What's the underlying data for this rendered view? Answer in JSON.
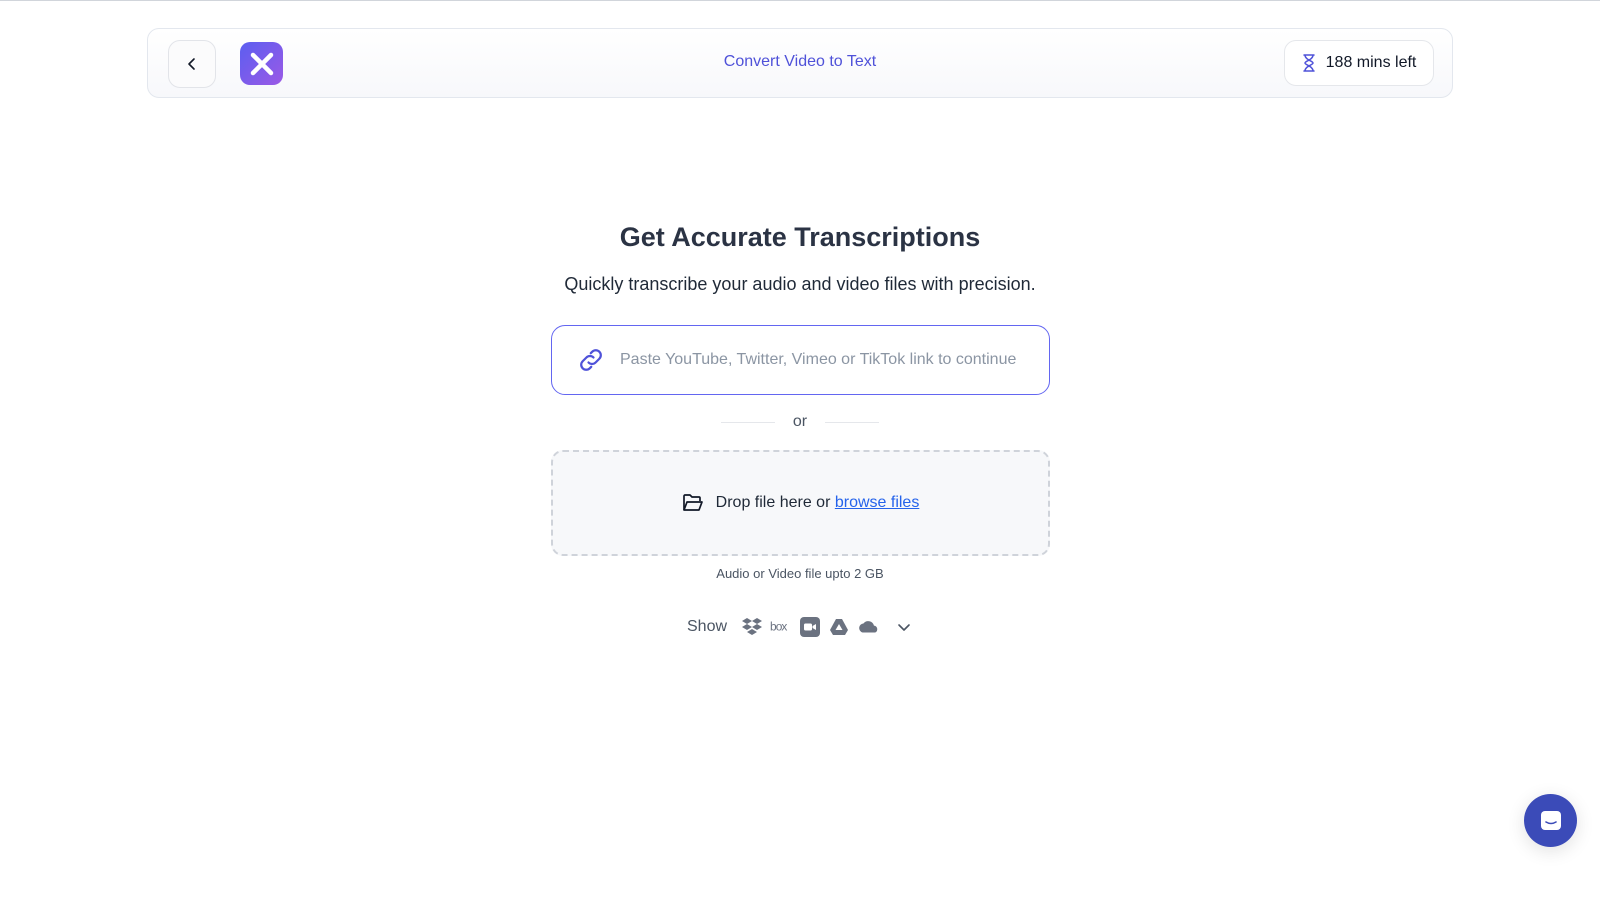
{
  "header": {
    "back_label": "Back",
    "logo_name": "app-logo",
    "title": "Convert Video to Text",
    "mins_left": "188 mins left"
  },
  "main": {
    "headline": "Get Accurate Transcriptions",
    "subheadline": "Quickly transcribe your audio and video files with precision.",
    "link_input": {
      "value": "",
      "placeholder": "Paste YouTube, Twitter, Vimeo or TikTok link to continue"
    },
    "or_label": "or",
    "dropzone": {
      "text": "Drop file here or",
      "browse_label": "browse files"
    },
    "file_hint": "Audio or Video file upto 2 GB",
    "show_label": "Show",
    "services": [
      "dropbox-icon",
      "box-icon",
      "zoom-icon",
      "google-drive-icon",
      "onedrive-icon"
    ]
  },
  "colors": {
    "accent": "#6366f1",
    "header_title": "#4f52d9",
    "link": "#2563eb",
    "chat_button": "#3b4bb8"
  }
}
